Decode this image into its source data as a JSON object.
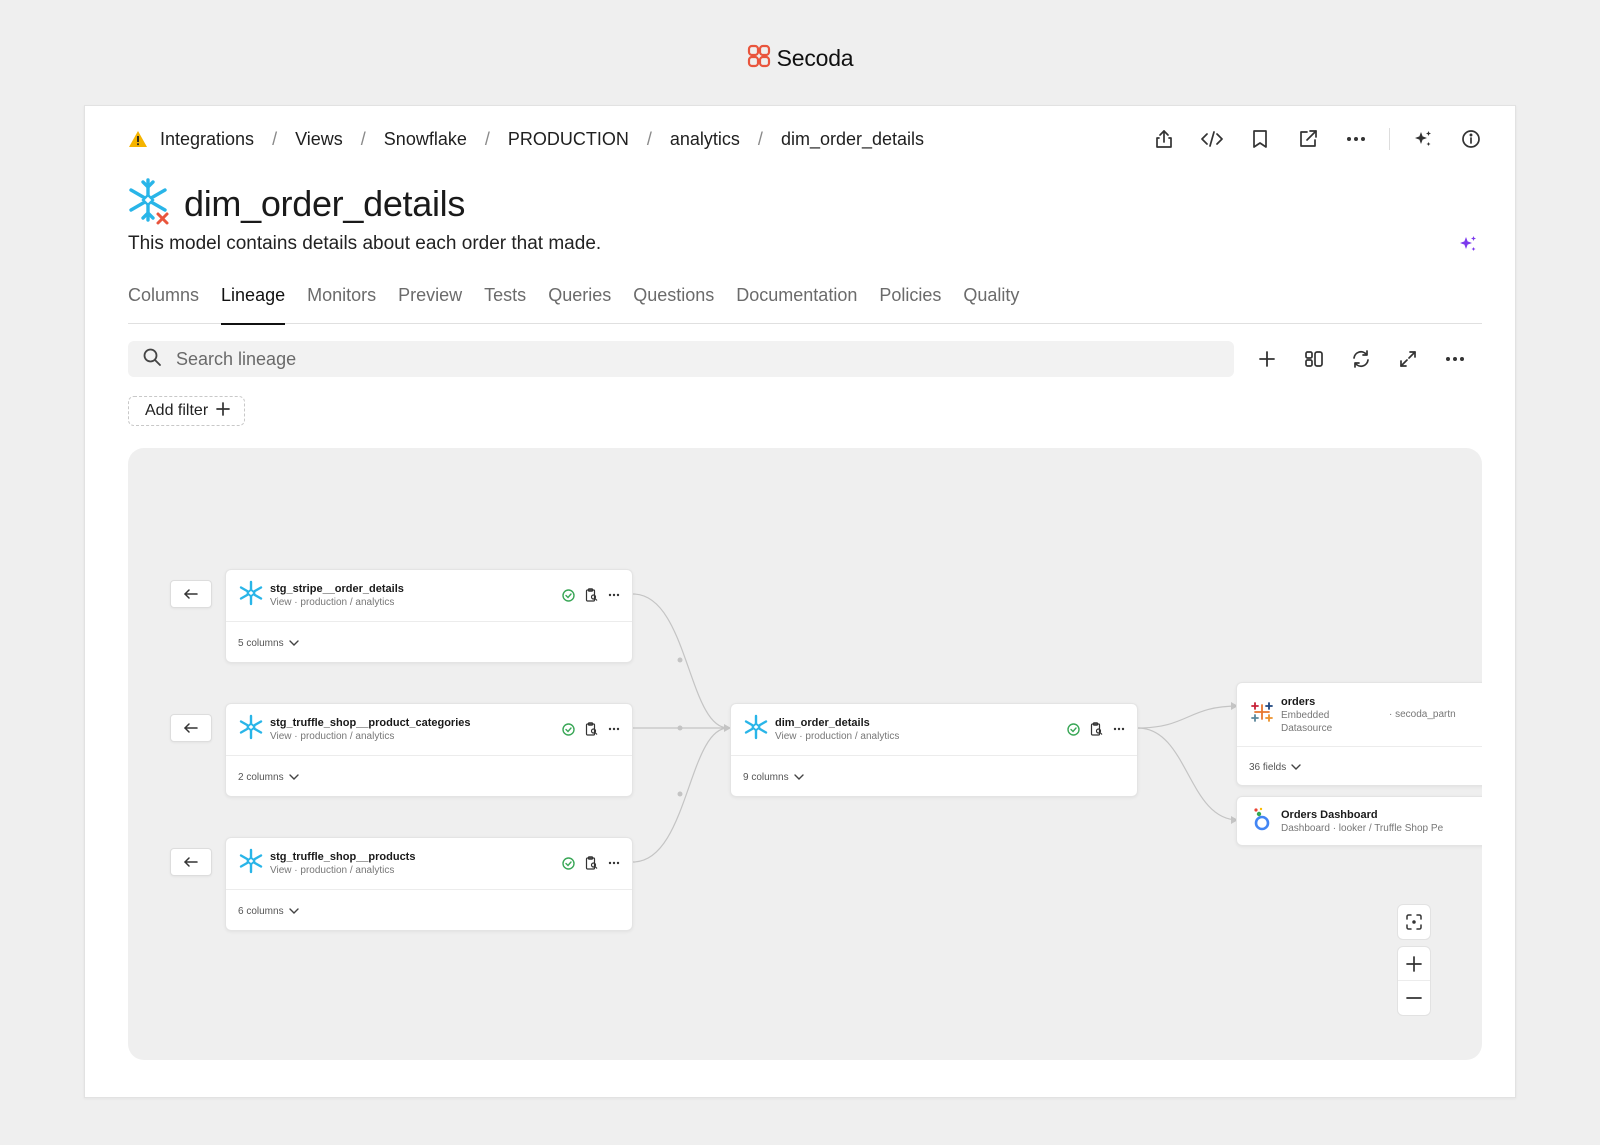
{
  "brand": {
    "name": "Secoda",
    "color": "#e9553d"
  },
  "breadcrumb": {
    "warning_icon": "warning-triangle-icon",
    "items": [
      "Integrations",
      "Views",
      "Snowflake",
      "PRODUCTION",
      "analytics",
      "dim_order_details"
    ],
    "separator": "/"
  },
  "header_actions": [
    "share-icon",
    "code-icon",
    "bookmark-icon",
    "external-link-icon",
    "more-icon",
    "ai-sparkle-icon",
    "info-icon"
  ],
  "page": {
    "title": "dim_order_details",
    "description": "This model contains details about each order that made.",
    "accent_color": "#7c3aed"
  },
  "tabs": [
    "Columns",
    "Lineage",
    "Monitors",
    "Preview",
    "Tests",
    "Queries",
    "Questions",
    "Documentation",
    "Policies",
    "Quality"
  ],
  "active_tab": "Lineage",
  "search": {
    "placeholder": "Search lineage"
  },
  "toolbar": [
    "add-icon",
    "layout-icon",
    "refresh-icon",
    "expand-icon",
    "more-icon"
  ],
  "add_filter": {
    "label": "Add filter"
  },
  "lineage": {
    "upstream": [
      {
        "name": "stg_stripe__order_details",
        "subtitle": "View · production / analytics",
        "columns": "5 columns"
      },
      {
        "name": "stg_truffle_shop__product_categories",
        "subtitle": "View · production / analytics",
        "columns": "2 columns"
      },
      {
        "name": "stg_truffle_shop__products",
        "subtitle": "View · production / analytics",
        "columns": "6 columns"
      }
    ],
    "center": {
      "name": "dim_order_details",
      "subtitle": "View · production / analytics",
      "columns": "9 columns"
    },
    "downstream": [
      {
        "name": "orders",
        "subtitle_line1": "Embedded",
        "subtitle_line2": "Datasource",
        "extra": "· secoda_partn",
        "fields": "36 fields"
      },
      {
        "name": "Orders Dashboard",
        "subtitle": "Dashboard · looker / Truffle Shop Pe"
      }
    ],
    "status_color": "#3aa757",
    "edge_color": "#c4c4c4"
  },
  "zoom_controls": [
    "fit-view-icon",
    "zoom-in-icon",
    "zoom-out-icon"
  ]
}
